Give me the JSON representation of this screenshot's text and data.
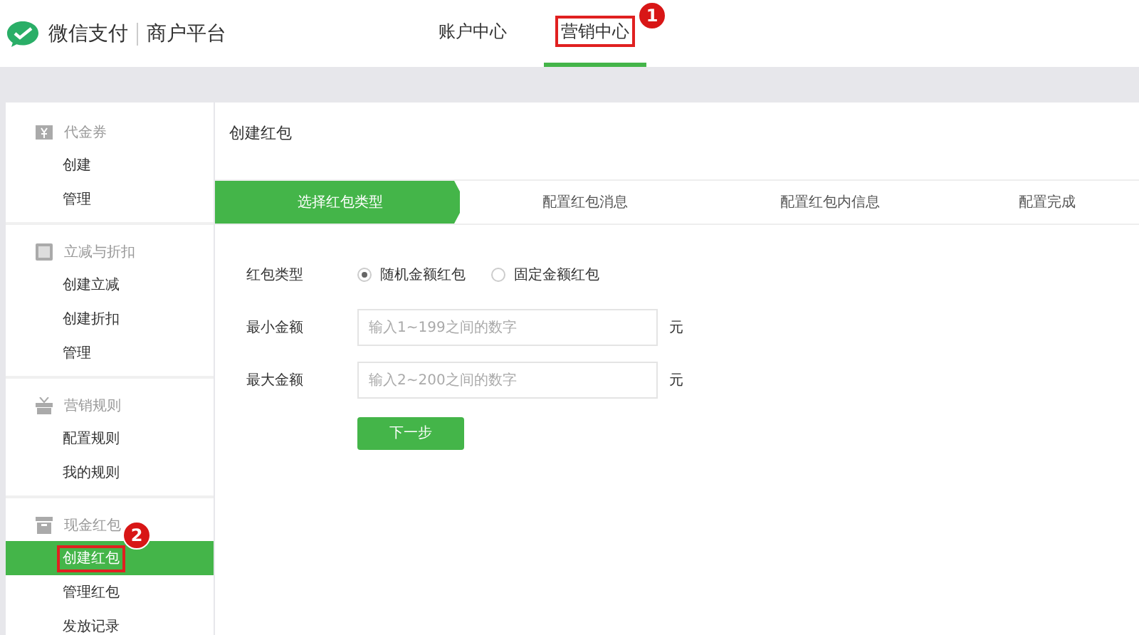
{
  "header": {
    "brand": "微信支付",
    "subtitle": "商户平台"
  },
  "tabs": [
    {
      "label": "账户中心",
      "selected": false
    },
    {
      "label": "营销中心",
      "selected": true,
      "callout": "1"
    }
  ],
  "sidebar": {
    "groups": [
      {
        "title": "代金券",
        "items": [
          {
            "label": "创建",
            "selected": false
          },
          {
            "label": "管理",
            "selected": false
          }
        ]
      },
      {
        "title": "立减与折扣",
        "items": [
          {
            "label": "创建立减",
            "selected": false
          },
          {
            "label": "创建折扣",
            "selected": false
          },
          {
            "label": "管理",
            "selected": false
          }
        ]
      },
      {
        "title": "营销规则",
        "items": [
          {
            "label": "配置规则",
            "selected": false
          },
          {
            "label": "我的规则",
            "selected": false
          }
        ]
      },
      {
        "title": "现金红包",
        "items": [
          {
            "label": "创建红包",
            "selected": true,
            "callout": "2"
          },
          {
            "label": "管理红包",
            "selected": false
          },
          {
            "label": "发放记录",
            "selected": false
          }
        ]
      }
    ]
  },
  "page_title": "创建红包",
  "steps": [
    {
      "label": "选择红包类型",
      "selected": true
    },
    {
      "label": "配置红包消息",
      "selected": false
    },
    {
      "label": "配置红包内信息",
      "selected": false
    },
    {
      "label": "配置完成",
      "selected": false
    }
  ],
  "form": {
    "type_label": "红包类型",
    "options": [
      {
        "label": "随机金额红包",
        "selected": true
      },
      {
        "label": "固定金额红包",
        "selected": false
      }
    ],
    "fields": [
      {
        "label": "最小金额",
        "placeholder": "输入1~199之间的数字",
        "unit": "元"
      },
      {
        "label": "最大金额",
        "placeholder": "输入2~200之间的数字",
        "unit": "元"
      }
    ],
    "button": "下一步"
  }
}
